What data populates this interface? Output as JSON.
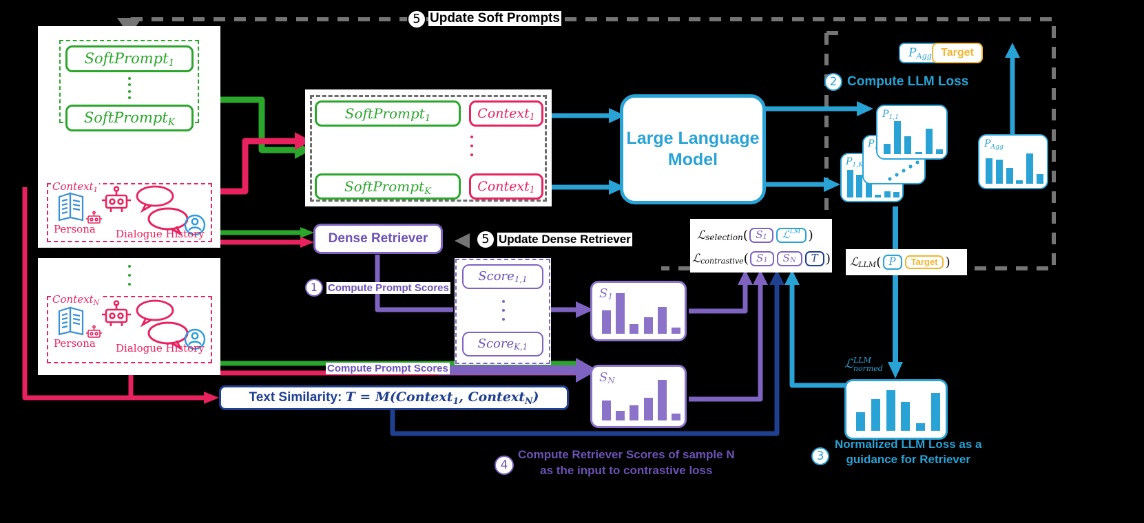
{
  "colors": {
    "green": "#2aa62a",
    "pink": "#e8225e",
    "blue": "#29a3d6",
    "purple": "#7e63c0",
    "purple_dark": "#6d52b5",
    "navy": "#1f3f8f",
    "gray": "#757575",
    "yellow": "#f2b630",
    "white": "#ffffff",
    "black": "#000000"
  },
  "steps": {
    "one": "1",
    "two": "2",
    "three": "3",
    "four": "4",
    "five": "5"
  },
  "top": {
    "update_soft_prompts": "Update Soft Prompts"
  },
  "prompt_pool": {
    "first": "SoftPrompt",
    "first_sub": "1",
    "last": "SoftPrompt",
    "last_sub": "K"
  },
  "context_block_1": {
    "label": "Context",
    "label_sub": "1",
    "persona": "Persona",
    "dialogue": "Dialogue History"
  },
  "context_block_n": {
    "label": "Context",
    "label_sub": "N",
    "persona": "Persona",
    "dialogue": "Dialogue History"
  },
  "pair_panel": {
    "rows": [
      {
        "prompt": "SoftPrompt",
        "prompt_sub": "1",
        "context": "Context",
        "context_sub": "1"
      },
      {
        "prompt": "SoftPrompt",
        "prompt_sub": "K",
        "context": "Context",
        "context_sub": "1"
      }
    ]
  },
  "llm": {
    "line1": "Large Language",
    "line2": "Model"
  },
  "llm_loss": {
    "caption": "Compute LLM Loss",
    "p_agg_chip": "P",
    "p_agg_chip_sub": "Agg",
    "target_chip": "Target"
  },
  "retriever": {
    "title": "Dense Retriever",
    "update_label": "Update Dense Retriever",
    "compute_prompt_scores_1": "Compute Prompt Scores",
    "compute_prompt_scores_2": "Compute Prompt Scores"
  },
  "score_panel": {
    "first": "Score",
    "first_sub": "1,1",
    "last": "Score",
    "last_sub": "K,1"
  },
  "text_similarity": {
    "prefix": "Text Similarity:",
    "formula": "T = M(Context",
    "sub1": "1",
    "mid": ", Context",
    "sub2": "N",
    "suffix": ")"
  },
  "losses": {
    "selection": {
      "name": "selection",
      "args": [
        "S1",
        "LLM"
      ]
    },
    "selection_tokens": [
      {
        "base": "S",
        "sub": "1",
        "type": "math",
        "color": "#7e63c0"
      },
      {
        "base": "L",
        "sup": "LM",
        "type": "cal",
        "color": "#29a3d6"
      }
    ],
    "contrastive_tokens": [
      {
        "base": "S",
        "sub": "1",
        "type": "math",
        "color": "#7e63c0"
      },
      {
        "base": "S",
        "sub": "N",
        "type": "math",
        "color": "#7e63c0"
      },
      {
        "base": "T",
        "sub": "",
        "type": "math",
        "color": "#1f3f8f"
      }
    ],
    "selection_name": "selection",
    "contrastive_name": "contrastive",
    "llm_name": "LLM",
    "llm_tokens": [
      {
        "base": "P",
        "type": "math",
        "color": "#29a3d6"
      },
      {
        "base": "Target",
        "type": "plain",
        "color": "#f2b630"
      }
    ],
    "normed_base": "L",
    "normed_sub": "normed",
    "normed_sup": "LLM"
  },
  "captions": {
    "step3_line1": "Normalized LLM Loss as a",
    "step3_line2": "guidance for Retriever",
    "step4_line1": "Compute Retriever Scores of sample N",
    "step4_line2": "as the input to contrastive loss"
  },
  "chart_data": [
    {
      "type": "bar",
      "name": "P_1,1",
      "label": "P",
      "label_sub": "1,1",
      "color": "#29a3d6",
      "values": [
        0.3,
        0.95,
        0.52,
        0.05,
        0.72,
        0.13
      ]
    },
    {
      "type": "bar",
      "name": "P_1,i",
      "label": "P",
      "label_sub": "1,i",
      "color": "#29a3d6",
      "values": []
    },
    {
      "type": "bar",
      "name": "P_1,K",
      "label": "P",
      "label_sub": "1,K",
      "color": "#29a3d6",
      "values": [
        0.88,
        0.72,
        0.46,
        0.08,
        0.2,
        0.18
      ]
    },
    {
      "type": "bar",
      "name": "P_Agg",
      "label": "P",
      "label_sub": "Agg",
      "color": "#29a3d6",
      "values": [
        0.78,
        0.72,
        0.48,
        0.1,
        0.92,
        0.3
      ]
    },
    {
      "type": "bar",
      "name": "S_1",
      "label": "S",
      "label_sub": "1",
      "color": "#8b73c9",
      "values": [
        0.55,
        0.95,
        0.22,
        0.38,
        0.62,
        0.14
      ]
    },
    {
      "type": "bar",
      "name": "S_N",
      "label": "S",
      "label_sub": "N",
      "color": "#8b73c9",
      "values": [
        0.46,
        0.22,
        0.34,
        0.52,
        0.92,
        0.16
      ]
    },
    {
      "type": "bar",
      "name": "L_normed_LLM",
      "label": "",
      "label_sub": "",
      "color": "#29a3d6",
      "values": [
        0.42,
        0.72,
        0.92,
        0.66,
        0.18,
        0.86
      ]
    }
  ]
}
